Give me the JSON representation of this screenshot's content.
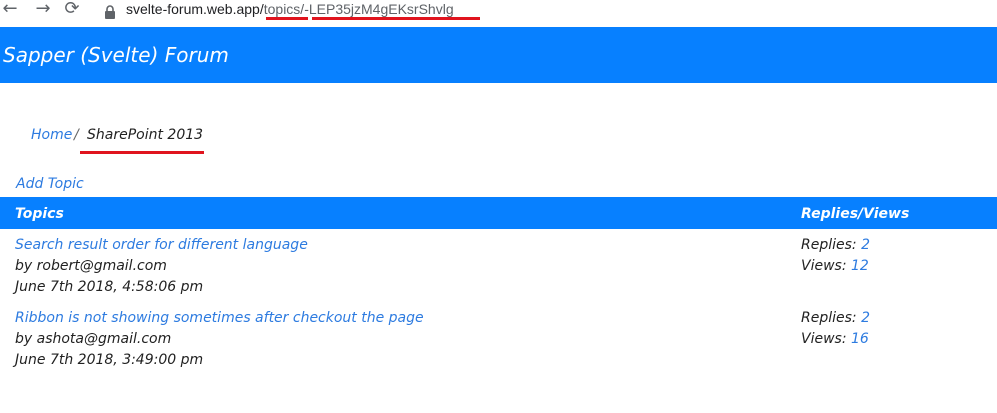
{
  "browser": {
    "url_host": "svelte-forum.web.app/",
    "url_path_segment": "topics/",
    "url_id": "-LEP35jzM4gEKsrShvlg"
  },
  "header": {
    "brand": "Sapper (Svelte)  Forum"
  },
  "breadcrumb": {
    "home": "Home",
    "separator": "/",
    "current": "SharePoint 2013"
  },
  "actions": {
    "add_topic": "Add Topic"
  },
  "table": {
    "col_topics": "Topics",
    "col_replies_views": "Replies/Views",
    "rows": [
      {
        "title": "Search result order for different language",
        "author": "by robert@gmail.com",
        "date": "June 7th 2018, 4:58:06 pm",
        "replies_label": "Replies:",
        "replies": "2",
        "views_label": "Views:",
        "views": "12"
      },
      {
        "title": "Ribbon is not showing sometimes after checkout the page",
        "author": "by ashota@gmail.com",
        "date": "June 7th 2018, 3:49:00 pm",
        "replies_label": "Replies:",
        "replies": "2",
        "views_label": "Views:",
        "views": "16"
      }
    ]
  },
  "colors": {
    "header_bg": "#0780ff",
    "link": "#2d7be0",
    "highlight_marker": "#e0141e"
  }
}
